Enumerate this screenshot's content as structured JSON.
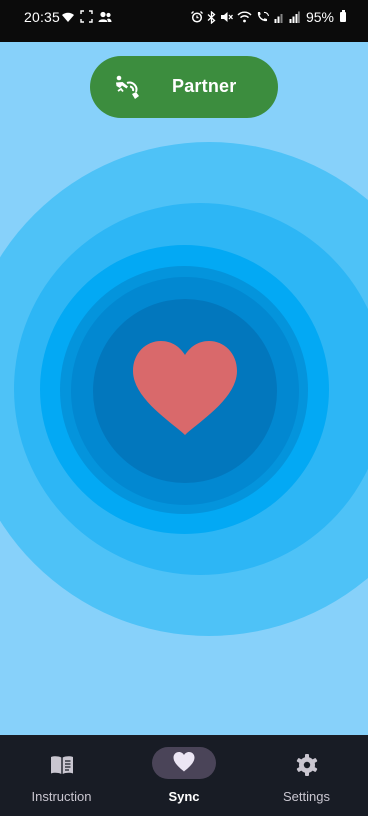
{
  "status_bar": {
    "time": "20:35",
    "battery_percent": "95%",
    "left_icons": [
      "wifi-icon",
      "screen-capture-icon",
      "contacts-icon"
    ],
    "right_icons": [
      "alarm-icon",
      "bluetooth-icon",
      "mute-icon",
      "wifi-icon",
      "wifi-call-icon",
      "signal-icon",
      "signal-icon",
      "battery-icon"
    ]
  },
  "partner_button": {
    "label": "Partner",
    "icon": "partner-touch-icon",
    "color": "#3c8d3e"
  },
  "pulse": {
    "icon": "heart-icon",
    "heart_color": "#d9696b",
    "ring_colors": [
      "#4ec2f7",
      "#2db6f5",
      "#03a9f4",
      "#0494dc",
      "#0288d1",
      "#0277bd"
    ],
    "background_color": "#87d1fa"
  },
  "bottom_nav": {
    "items": [
      {
        "label": "Instruction",
        "icon": "book-icon",
        "active": false
      },
      {
        "label": "Sync",
        "icon": "heart-icon",
        "active": true
      },
      {
        "label": "Settings",
        "icon": "gear-icon",
        "active": false
      }
    ]
  }
}
